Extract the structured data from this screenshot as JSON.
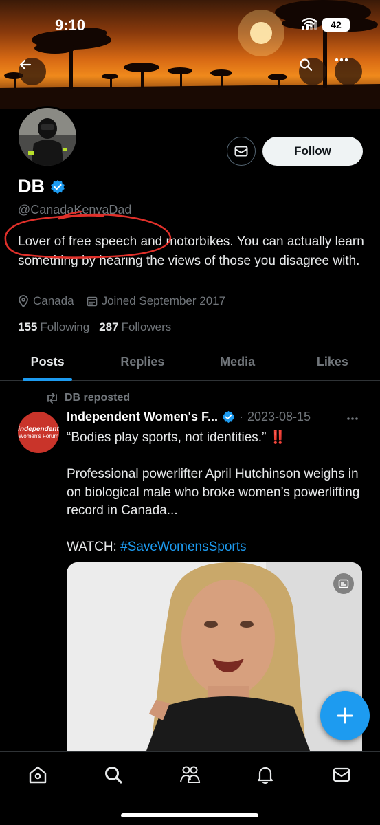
{
  "status_bar": {
    "time": "9:10",
    "battery": "42"
  },
  "header": {
    "back_icon": "arrow-left-icon",
    "search_icon": "search-icon",
    "more_icon": "more-icon"
  },
  "profile": {
    "name": "DB",
    "verified": true,
    "handle": "@CanadaKenyaDad",
    "bio": "Lover of free speech and motorbikes. You can actually learn something by hearing the views of those you disagree with.",
    "location": "Canada",
    "joined": "Joined September 2017",
    "following_count": "155",
    "following_label": "Following",
    "followers_count": "287",
    "followers_label": "Followers",
    "follow_label": "Follow"
  },
  "tabs": [
    {
      "label": "Posts",
      "active": true
    },
    {
      "label": "Replies",
      "active": false
    },
    {
      "label": "Media",
      "active": false
    },
    {
      "label": "Likes",
      "active": false
    }
  ],
  "post": {
    "repost_label": "DB reposted",
    "author": "Independent Women's F...",
    "date": "2023-08-15",
    "avatar_text_line1": "independent",
    "avatar_text_line2": "Women's Forum",
    "quote": "“Bodies play sports, not identities.”",
    "quote_emoji": "‼️",
    "body": "Professional powerlifter April Hutchinson weighs in on biological male who broke women’s powerlifting record in Canada...",
    "watch_label": "WATCH:",
    "hashtag": "#SaveWomensSports"
  },
  "bottom_nav": [
    "home-icon",
    "search-icon",
    "communities-icon",
    "notifications-icon",
    "messages-icon"
  ],
  "colors": {
    "accent": "#1d9bf0",
    "background": "#000000",
    "muted": "#71767b",
    "annotation": "#e0302a"
  }
}
